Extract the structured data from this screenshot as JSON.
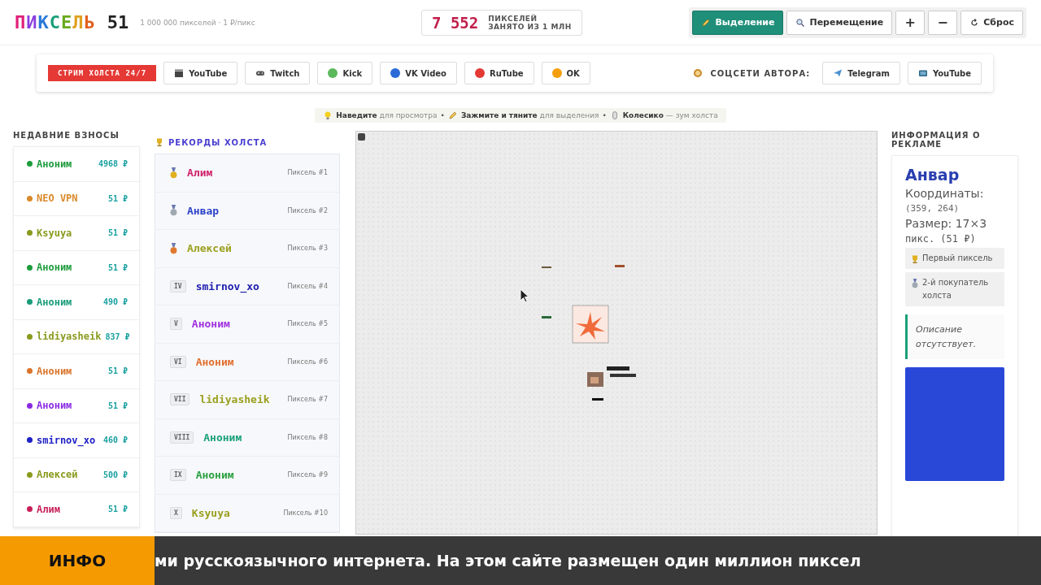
{
  "header": {
    "logo": "ПИКСЕЛЬ",
    "price": "51",
    "subtitle": "1 000 000 пикселей · 1 ₽/пикс",
    "counter": {
      "value": "7 552",
      "line_1": "ПИКСЕЛЕЙ",
      "line_2": "ЗАНЯТО ИЗ 1 МЛН"
    },
    "tools": [
      {
        "kind": "pencil",
        "label": "Выделение",
        "selected": true
      },
      {
        "kind": "search",
        "label": "Перемещение",
        "selected": false
      },
      {
        "kind": "text",
        "label": "+",
        "selected": false
      },
      {
        "kind": "text",
        "label": "−",
        "selected": false
      },
      {
        "kind": "reset",
        "label": "Сброс",
        "selected": false
      }
    ]
  },
  "social_bar": {
    "stream": "СТРИМ ХОЛСТА 24/7",
    "links": [
      {
        "kind": "film",
        "label": "YouTube"
      },
      {
        "kind": "gamepad",
        "label": "Twitch"
      },
      {
        "kind": "dot",
        "label": "Kick",
        "color": "#5cb85c"
      },
      {
        "kind": "dot",
        "label": "VK Video",
        "color": "#2a6ad8"
      },
      {
        "kind": "dot",
        "label": "RuTube",
        "color": "#e53935"
      },
      {
        "kind": "dot",
        "label": "OK",
        "color": "#f59e0b"
      }
    ],
    "author_label": "СОЦСЕТИ АВТОРА:",
    "author_links": [
      {
        "kind": "plane",
        "label": "Telegram"
      },
      {
        "kind": "tv",
        "label": "YouTube"
      }
    ]
  },
  "hints": {
    "separator": "•",
    "items": [
      {
        "kind": "bulb",
        "text": "**Наведите** для просмотра"
      },
      {
        "kind": "pencil",
        "text": "**Зажмите и тяните** для выделения"
      },
      {
        "kind": "mouse",
        "text": "**Колесико** — зум холста"
      }
    ]
  },
  "recent": {
    "title": "НЕДАВНИЕ ВЗНОСЫ",
    "items": [
      {
        "name": "Аноним",
        "amount": "4968 ₽",
        "color": "#1e9b3c"
      },
      {
        "name": "NEO VPN",
        "amount": "51 ₽",
        "color": "#d98a2b"
      },
      {
        "name": "Ksyuya",
        "amount": "51 ₽",
        "color": "#8a9a1e"
      },
      {
        "name": "Аноним",
        "amount": "51 ₽",
        "color": "#1e9b3c"
      },
      {
        "name": "Аноним",
        "amount": "490 ₽",
        "color": "#1a9c7a"
      },
      {
        "name": "lidiyasheik",
        "amount": "837 ₽",
        "color": "#8a9a1e"
      },
      {
        "name": "Аноним",
        "amount": "51 ₽",
        "color": "#d9742b"
      },
      {
        "name": "Аноним",
        "amount": "51 ₽",
        "color": "#8a2be2"
      },
      {
        "name": "smirnov_xo",
        "amount": "460 ₽",
        "color": "#2020c8"
      },
      {
        "name": "Алексей",
        "amount": "500 ₽",
        "color": "#8a9a1e"
      },
      {
        "name": "Алим",
        "amount": "51 ₽",
        "color": "#c8205a"
      }
    ]
  },
  "records": {
    "title": "РЕКОРДЫ ХОЛСТА",
    "items": [
      {
        "kind": "gold",
        "name": "Алим",
        "pixel": "Пиксель #1",
        "color": "#d0206a"
      },
      {
        "kind": "silver",
        "name": "Анвар",
        "pixel": "Пиксель #2",
        "color": "#2a3fc8"
      },
      {
        "kind": "bronze",
        "name": "Алексей",
        "pixel": "Пиксель #3",
        "color": "#9aa01e"
      },
      {
        "kind": "numeral",
        "rank": "IV",
        "name": "smirnov_xo",
        "pixel": "Пиксель #4",
        "color": "#2020b0"
      },
      {
        "kind": "numeral",
        "rank": "V",
        "name": "Аноним",
        "pixel": "Пиксель #5",
        "color": "#a030e0"
      },
      {
        "kind": "numeral",
        "rank": "VI",
        "name": "Аноним",
        "pixel": "Пиксель #6",
        "color": "#e07030"
      },
      {
        "kind": "numeral",
        "rank": "VII",
        "name": "lidiyasheik",
        "pixel": "Пиксель #7",
        "color": "#9aa01e"
      },
      {
        "kind": "numeral",
        "rank": "VIII",
        "name": "Аноним",
        "pixel": "Пиксель #8",
        "color": "#1aa07a"
      },
      {
        "kind": "numeral",
        "rank": "IX",
        "name": "Аноним",
        "pixel": "Пиксель #9",
        "color": "#2aa040"
      },
      {
        "kind": "numeral",
        "rank": "X",
        "name": "Ksyuya",
        "pixel": "Пиксель #10",
        "color": "#9aa01e"
      }
    ]
  },
  "ad_info": {
    "title": "ИНФОРМАЦИЯ О РЕКЛАМЕ",
    "name": "Анвар",
    "coords_label": "Координаты:",
    "coords": "(359, 264)",
    "size_label": "Размер: 17×3",
    "size_value": "пикс. (51 ₽)",
    "badges": [
      {
        "kind": "trophy",
        "text": "Первый пиксель"
      },
      {
        "kind": "medal",
        "text": "2-й покупатель холста"
      }
    ],
    "description": "Описание отсутствует."
  },
  "ticker": {
    "label": "ИНФО",
    "text": "ми русскоязычного интернета. На этом сайте размещен один миллион пиксел"
  }
}
